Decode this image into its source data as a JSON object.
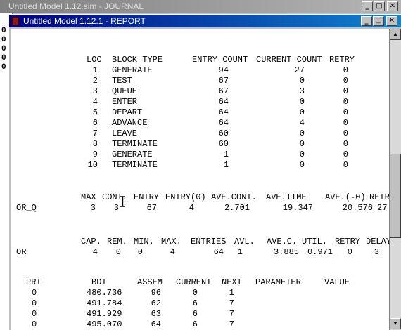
{
  "journal_window": {
    "title": "Untitled Model 1.12.sim - JOURNAL",
    "gutter_digits": [
      "0",
      "0",
      "0",
      "0",
      "0"
    ]
  },
  "report_window": {
    "title": "Untitled Model 1.12.1 - REPORT"
  },
  "controls": {
    "minimize": "_",
    "maximize": "□",
    "close": "✕",
    "scroll_up": "▲",
    "scroll_down": "▼"
  },
  "blocks": {
    "headers": [
      "LOC",
      "BLOCK TYPE",
      "ENTRY COUNT",
      "CURRENT COUNT",
      "RETRY"
    ],
    "rows": [
      {
        "loc": "1",
        "type": "GENERATE",
        "entry": "94",
        "current": "27",
        "retry": "0"
      },
      {
        "loc": "2",
        "type": "TEST",
        "entry": "67",
        "current": "0",
        "retry": "0"
      },
      {
        "loc": "3",
        "type": "QUEUE",
        "entry": "67",
        "current": "3",
        "retry": "0"
      },
      {
        "loc": "4",
        "type": "ENTER",
        "entry": "64",
        "current": "0",
        "retry": "0"
      },
      {
        "loc": "5",
        "type": "DEPART",
        "entry": "64",
        "current": "0",
        "retry": "0"
      },
      {
        "loc": "6",
        "type": "ADVANCE",
        "entry": "64",
        "current": "4",
        "retry": "0"
      },
      {
        "loc": "7",
        "type": "LEAVE",
        "entry": "60",
        "current": "0",
        "retry": "0"
      },
      {
        "loc": "8",
        "type": "TERMINATE",
        "entry": "60",
        "current": "0",
        "retry": "0"
      },
      {
        "loc": "9",
        "type": "GENERATE",
        "entry": "1",
        "current": "0",
        "retry": "0"
      },
      {
        "loc": "10",
        "type": "TERMINATE",
        "entry": "1",
        "current": "0",
        "retry": "0"
      }
    ]
  },
  "queue": {
    "headers": [
      "MAX",
      "CONT.",
      "ENTRY",
      "ENTRY(0)",
      "AVE.CONT.",
      "AVE.TIME",
      "AVE.(-0)",
      "RETR"
    ],
    "row": {
      "name": "OR_Q",
      "max": "3",
      "cont": "3",
      "entry": "67",
      "entry0": "4",
      "avecont": "2.701",
      "avetime": "19.347",
      "aveminus0": "20.576",
      "retry": "27"
    }
  },
  "storage": {
    "headers": [
      "CAP.",
      "REM.",
      "MIN.",
      "MAX.",
      "ENTRIES",
      "AVL.",
      "AVE.C.",
      "UTIL.",
      "RETRY",
      "DELAY"
    ],
    "row": {
      "name": "OR",
      "cap": "4",
      "rem": "0",
      "min": "0",
      "max": "4",
      "entries": "64",
      "avl": "1",
      "avec": "3.885",
      "util": "0.971",
      "retry": "0",
      "delay": "3"
    }
  },
  "fec": {
    "headers": [
      "PRI",
      "BDT",
      "ASSEM",
      "CURRENT",
      "NEXT",
      "PARAMETER",
      "VALUE"
    ],
    "rows": [
      {
        "pri": "0",
        "bdt": "480.736",
        "assem": "96",
        "current": "0",
        "next": "1"
      },
      {
        "pri": "0",
        "bdt": "491.784",
        "assem": "62",
        "current": "6",
        "next": "7"
      },
      {
        "pri": "0",
        "bdt": "491.929",
        "assem": "63",
        "current": "6",
        "next": "7"
      },
      {
        "pri": "0",
        "bdt": "495.070",
        "assem": "64",
        "current": "6",
        "next": "7"
      }
    ]
  }
}
